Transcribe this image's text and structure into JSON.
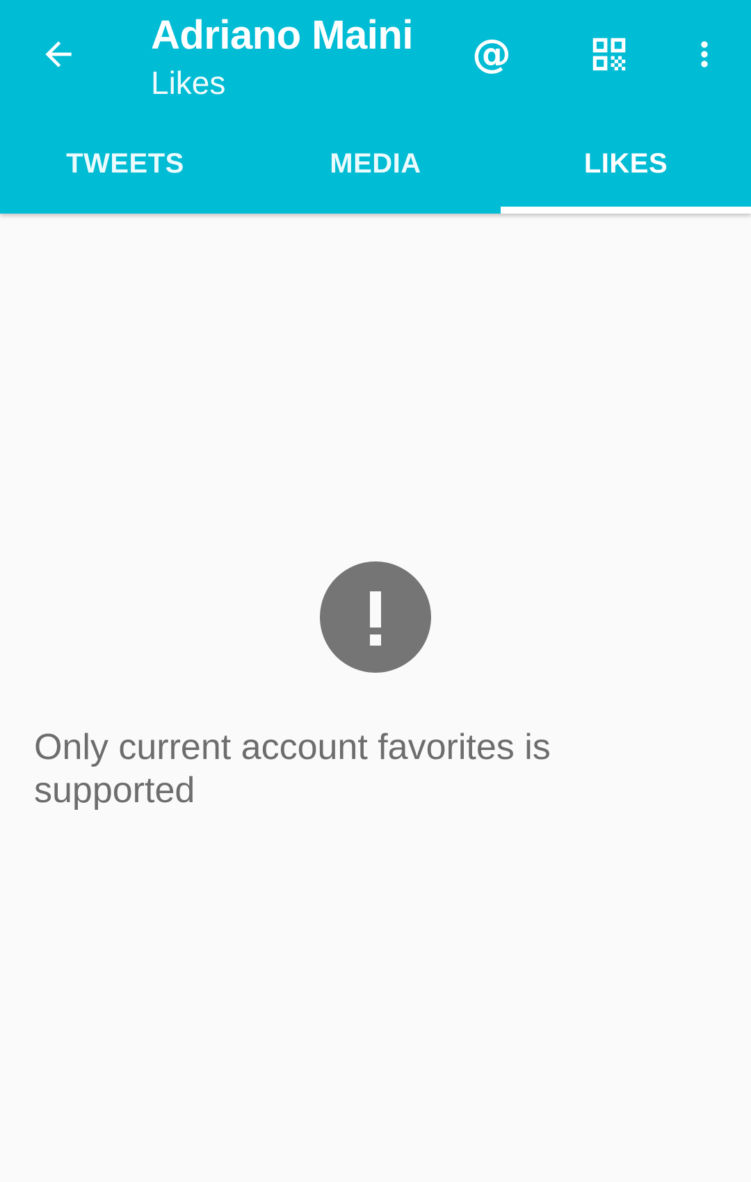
{
  "toolbar": {
    "title": "Adriano Maini",
    "subtitle": "Likes",
    "back_icon": "arrow-back-icon",
    "mention_label": "@",
    "qr_icon": "qr-code-icon",
    "more_icon": "more-vertical-icon"
  },
  "tabs": [
    {
      "label": "TWEETS",
      "selected": false
    },
    {
      "label": "MEDIA",
      "selected": false
    },
    {
      "label": "LIKES",
      "selected": true
    }
  ],
  "empty_state": {
    "icon": "error-icon",
    "message": "Only current account favorites is supported"
  },
  "colors": {
    "primary": "#00bcd4",
    "background": "#fafafa",
    "icon_gray": "#757575",
    "text_gray": "#6d6d6d"
  }
}
